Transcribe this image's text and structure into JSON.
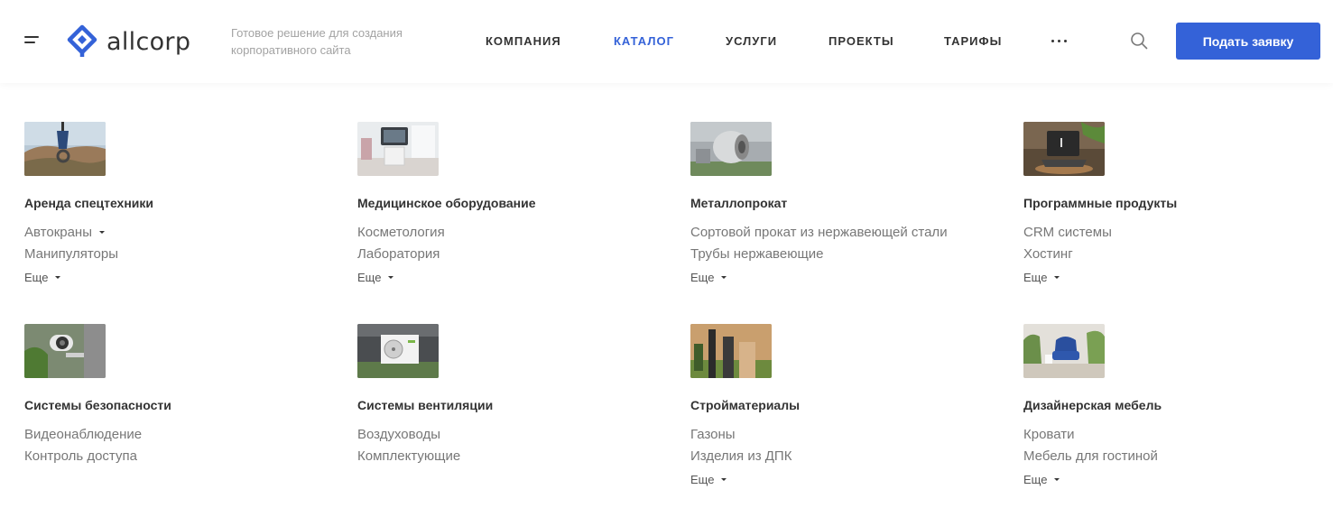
{
  "header": {
    "logo_text": "allcorp",
    "tagline": "Готовое решение для создания корпоративного сайта",
    "nav": [
      {
        "label": "КОМПАНИЯ",
        "active": false
      },
      {
        "label": "КАТАЛОГ",
        "active": true
      },
      {
        "label": "УСЛУГИ",
        "active": false
      },
      {
        "label": "ПРОЕКТЫ",
        "active": false
      },
      {
        "label": "ТАРИФЫ",
        "active": false
      }
    ],
    "cta_label": "Подать заявку",
    "accent_color": "#3462d8"
  },
  "catalog": [
    {
      "title": "Аренда спецтехники",
      "items": [
        "Автокраны",
        "Манипуляторы"
      ],
      "first_item_has_caret": true,
      "more_label": "Еще"
    },
    {
      "title": "Медицинское оборудование",
      "items": [
        "Косметология",
        "Лаборатория"
      ],
      "more_label": "Еще"
    },
    {
      "title": "Металлопрокат",
      "items": [
        "Сортовой прокат из нержавеющей стали",
        "Трубы нержавеющие"
      ],
      "more_label": "Еще"
    },
    {
      "title": "Программные продукты",
      "items": [
        "CRM системы",
        "Хостинг"
      ],
      "more_label": "Еще"
    },
    {
      "title": "Системы безопасности",
      "items": [
        "Видеонаблюдение",
        "Контроль доступа"
      ]
    },
    {
      "title": "Системы вентиляции",
      "items": [
        "Воздуховоды",
        "Комплектующие"
      ]
    },
    {
      "title": "Стройматериалы",
      "items": [
        "Газоны",
        "Изделия из ДПК"
      ],
      "more_label": "Еще"
    },
    {
      "title": "Дизайнерская мебель",
      "items": [
        "Кровати",
        "Мебель для гостиной"
      ],
      "more_label": "Еще"
    }
  ]
}
